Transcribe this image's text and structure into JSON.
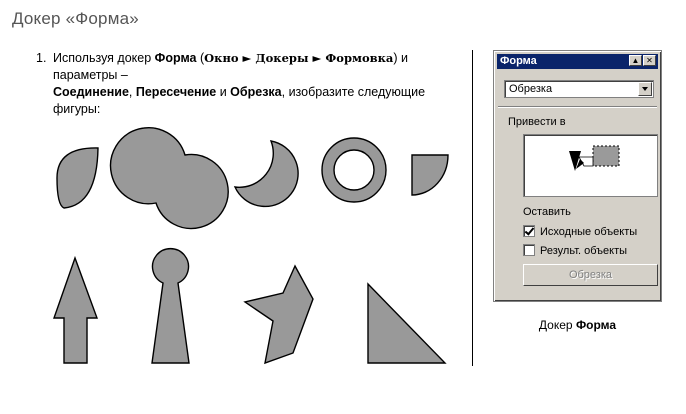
{
  "header": {
    "title": "Докер «Форма»"
  },
  "task": {
    "number": "1.",
    "t1": "Используя докер ",
    "b1": "Форма",
    "t2": " (",
    "m1": "Окно",
    "arrow1": " ► ",
    "m2": "Докеры",
    "arrow2": " ► ",
    "m3": "Формовка",
    "t3": ") и параметры –",
    "b2": "Соединение",
    "t4": ", ",
    "b3": "Пересечение",
    "t5": " и ",
    "b4": "Обрезка",
    "t6": ", изобразите следующие фигуры:"
  },
  "figures": {
    "fill": "#999999",
    "stroke": "#000000",
    "items": [
      "lens",
      "union-circles",
      "crescent",
      "ring",
      "quarter-circle",
      "arrow",
      "keyhole",
      "star-fragment",
      "triangle"
    ]
  },
  "docker": {
    "title": "Форма",
    "min_icon": "▲",
    "close_icon": "✕",
    "mode_value": "Обрезка",
    "apply_to_label": "Привести в",
    "leave_label": "Оставить",
    "options": [
      {
        "label": "Исходные объекты",
        "checked": true
      },
      {
        "label": "Результ. объекты",
        "checked": false
      }
    ],
    "action_button": "Обрезка"
  },
  "caption": {
    "prefix": "Докер ",
    "bold": "Форма"
  }
}
